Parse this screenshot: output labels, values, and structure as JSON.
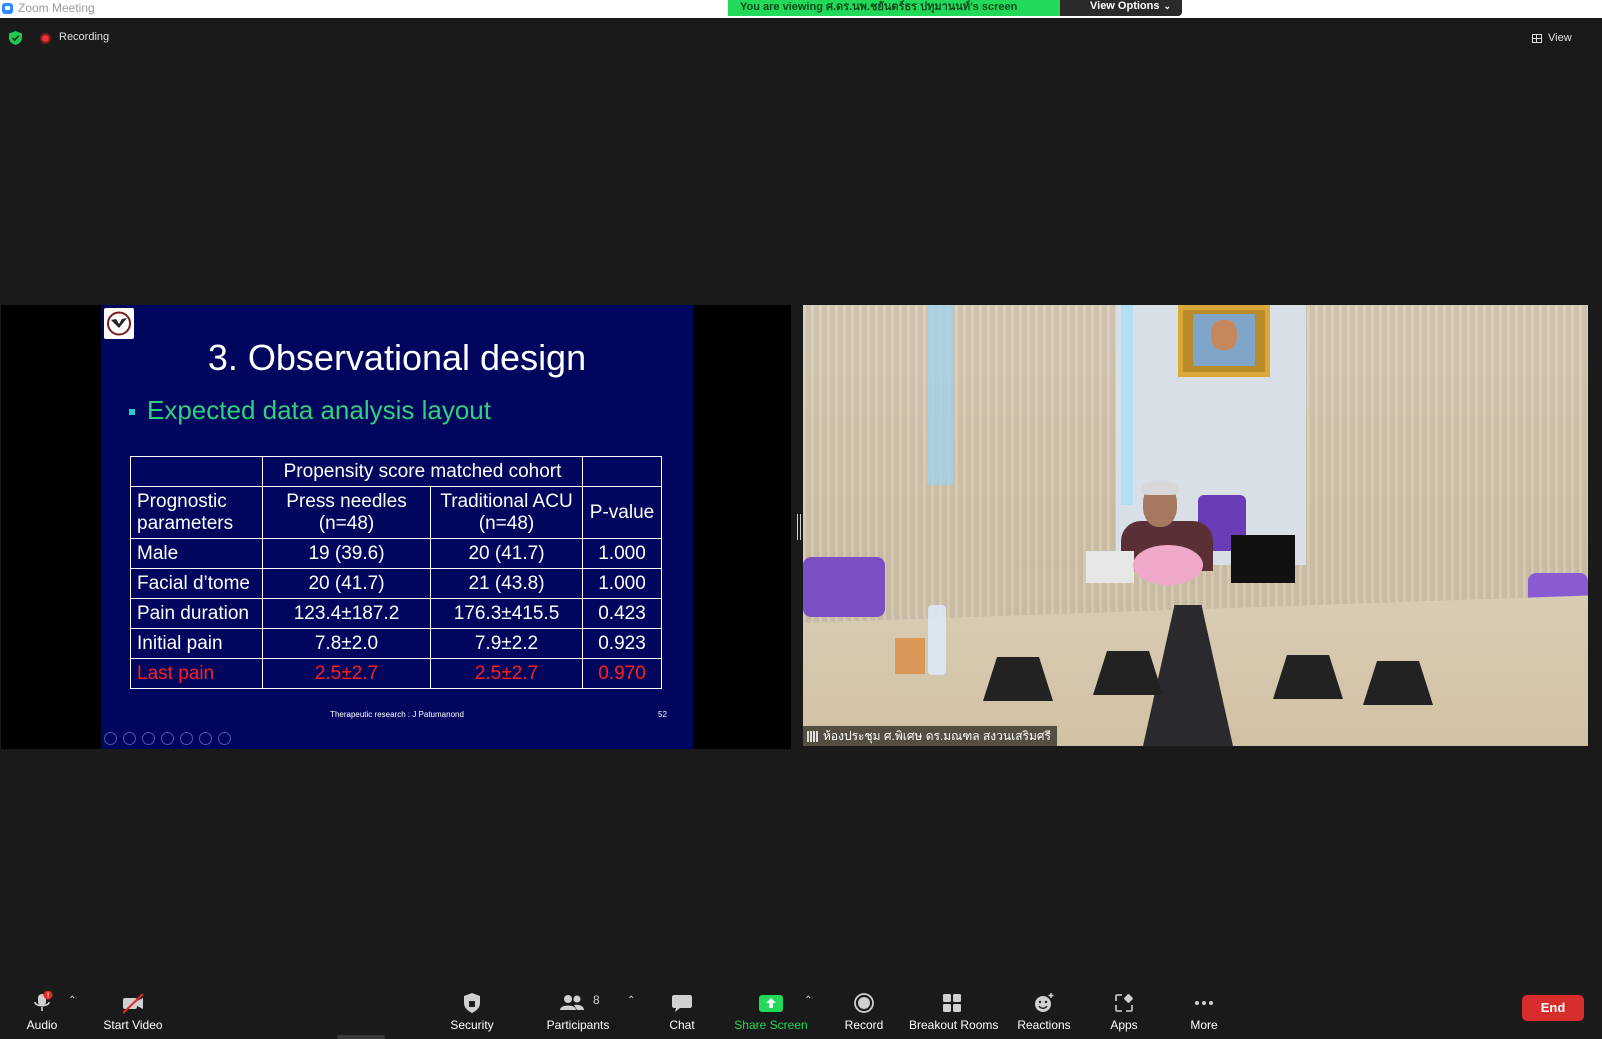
{
  "window": {
    "title": "Zoom Meeting"
  },
  "banner": {
    "viewing_text": "You are viewing ศ.ดร.นพ.ชยันตร์ธร ปทุมานนท์'s screen",
    "view_options": "View Options"
  },
  "status": {
    "recording": "Recording",
    "view": "View"
  },
  "slide": {
    "title": "3. Observational design",
    "bullet": "Expected data analysis layout",
    "table": {
      "group_header": "Propensity score matched cohort",
      "headers": {
        "param": [
          "Prognostic",
          "parameters"
        ],
        "press": [
          "Press needles",
          "(n=48)"
        ],
        "acu": [
          "Traditional ACU",
          "(n=48)"
        ],
        "p": "P-value"
      },
      "rows": [
        {
          "param": "Male",
          "press": "19 (39.6)",
          "acu": "20 (41.7)",
          "p": "1.000"
        },
        {
          "param": "Facial d’tome",
          "press": "20 (41.7)",
          "acu": "21 (43.8)",
          "p": "1.000"
        },
        {
          "param": "Pain duration",
          "press": "123.4±187.2",
          "acu": "176.3±415.5",
          "p": "0.423"
        },
        {
          "param": "Initial pain",
          "press": "7.8±2.0",
          "acu": "7.9±2.2",
          "p": "0.923"
        },
        {
          "param": "Last pain",
          "press": "2.5±2.7",
          "acu": "2.5±2.7",
          "p": "0.970"
        }
      ]
    },
    "footer": "Therapeutic research : J Patumanond",
    "page_number": "52"
  },
  "video": {
    "participant_name": "ห้องประชุม ศ.พิเศษ ดร.มณฑล สงวนเสริมศรี"
  },
  "toolbar": {
    "audio": "Audio",
    "audio_badge": "!",
    "start_video": "Start Video",
    "security": "Security",
    "participants": "Participants",
    "participants_count": "8",
    "chat": "Chat",
    "share_screen": "Share Screen",
    "record": "Record",
    "breakout_rooms": "Breakout Rooms",
    "reactions": "Reactions",
    "apps": "Apps",
    "more": "More",
    "end": "End"
  },
  "colors": {
    "share_green": "#23d959",
    "end_red": "#d62c2c",
    "slide_bg": "#00055e",
    "highlight_red": "#ff1f1f"
  }
}
